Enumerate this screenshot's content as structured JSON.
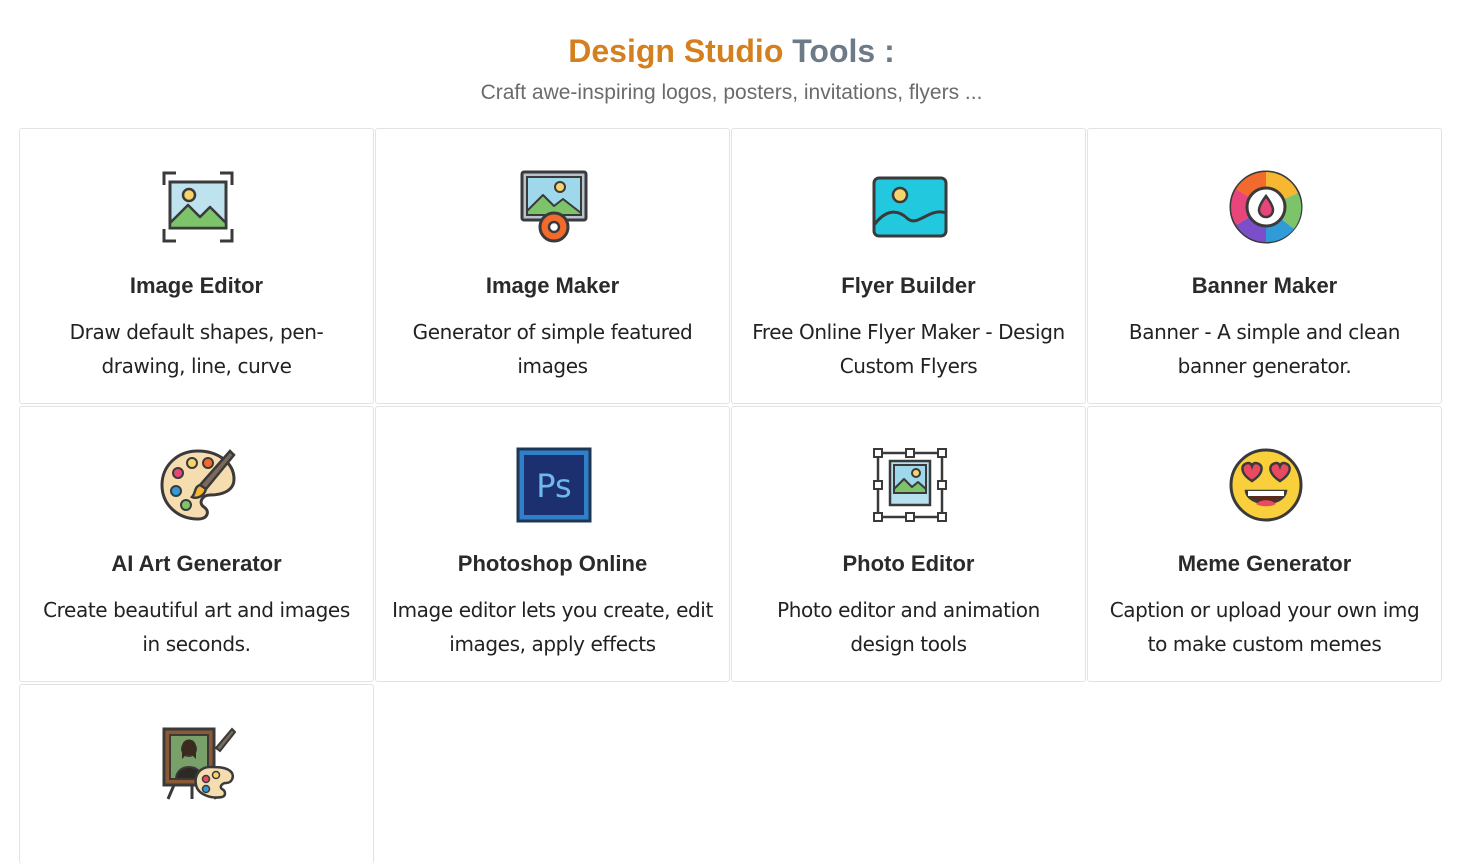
{
  "header": {
    "title_brand": "Design Studio",
    "title_rest": "Tools :",
    "subtitle": "Craft awe-inspiring logos, posters, invitations, flyers ..."
  },
  "colors": {
    "brand": "#d4801f",
    "title_gray": "#6d7a87",
    "subtitle_gray": "#6b6b6b",
    "border": "#e3e3e3"
  },
  "tools": [
    {
      "name": "Image Editor",
      "desc": "Draw default shapes, pen-drawing, line, curve",
      "icon": "image-frame-icon"
    },
    {
      "name": "Image Maker",
      "desc": "Generator of simple featured images",
      "icon": "image-gear-icon"
    },
    {
      "name": "Flyer Builder",
      "desc": "Free Online Flyer Maker - Design Custom Flyers",
      "icon": "picture-icon"
    },
    {
      "name": "Banner Maker",
      "desc": "Banner - A simple and clean banner generator.",
      "icon": "color-wheel-icon"
    },
    {
      "name": "AI Art Generator",
      "desc": "Create beautiful art and images in seconds.",
      "icon": "paint-palette-icon"
    },
    {
      "name": "Photoshop Online",
      "desc": "Image editor lets you create, edit images, apply effects",
      "icon": "photoshop-icon"
    },
    {
      "name": "Photo Editor",
      "desc": "Photo editor and animation design tools",
      "icon": "photo-select-icon"
    },
    {
      "name": "Meme Generator",
      "desc": "Caption or upload your own img to make custom memes",
      "icon": "heart-eyes-emoji-icon"
    },
    {
      "name": "",
      "desc": "",
      "icon": "easel-painting-icon"
    }
  ]
}
